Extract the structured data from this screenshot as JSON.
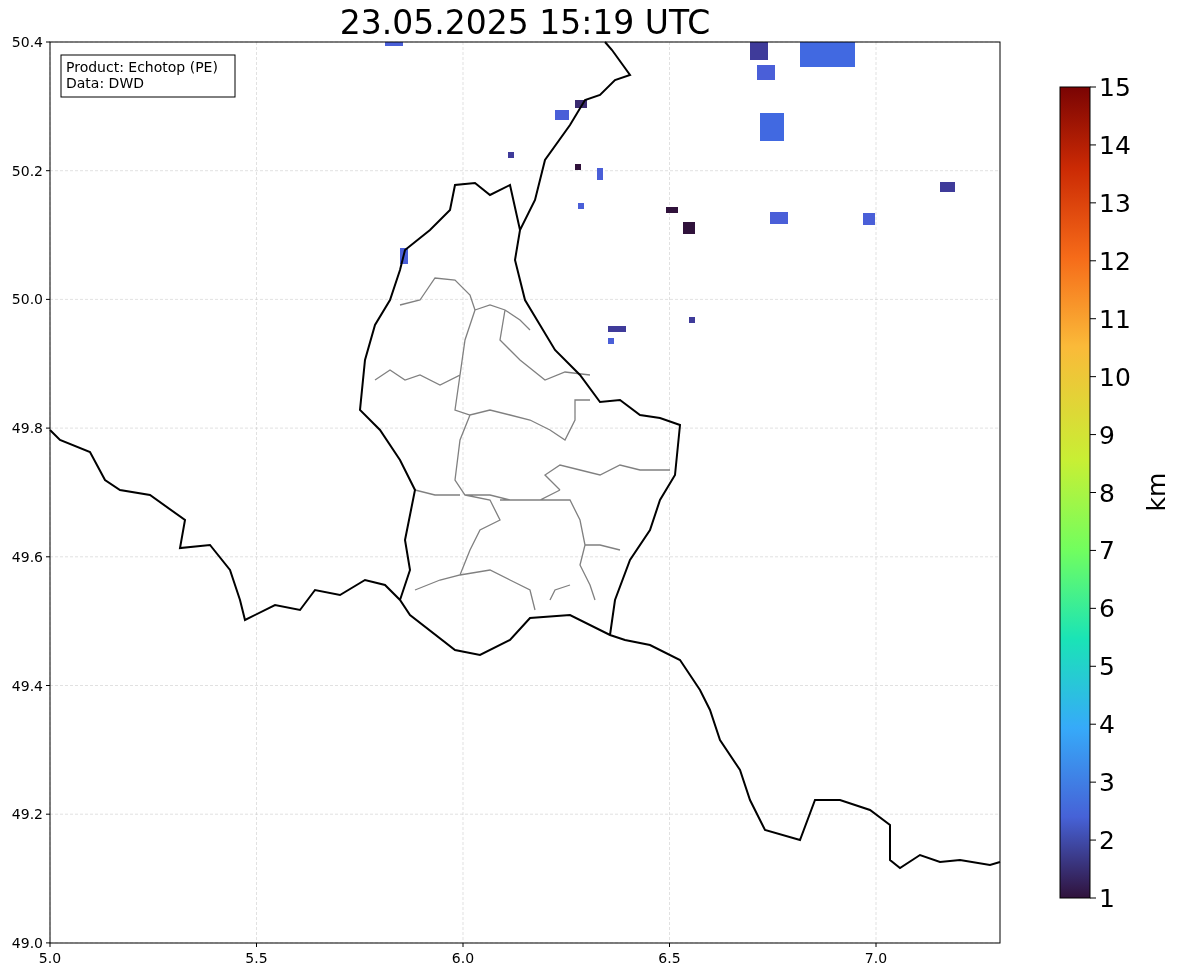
{
  "title": "23.05.2025 15:19 UTC",
  "info_box": [
    "Product: Echotop (PE)",
    "Data: DWD"
  ],
  "map": {
    "x_ticks": [
      "5.0",
      "5.5",
      "6.0",
      "6.5",
      "7.0"
    ],
    "y_ticks": [
      "50.4",
      "50.2",
      "50.0",
      "49.8",
      "49.6",
      "49.4",
      "49.2",
      "49.0"
    ]
  },
  "colorbar": {
    "label": "km",
    "ticks": [
      "15",
      "14",
      "13",
      "12",
      "11",
      "10",
      "9",
      "8",
      "7",
      "6",
      "5",
      "4",
      "3",
      "2",
      "1"
    ]
  }
}
